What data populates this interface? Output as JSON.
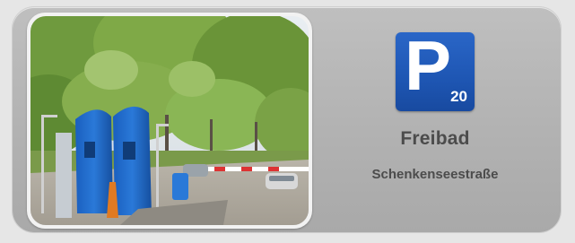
{
  "parking": {
    "sign_letter": "P",
    "sign_number": "20",
    "name": "Freibad",
    "street": "Schenkenseestraße"
  },
  "photo": {
    "icon": "parking-lot-photo"
  },
  "colors": {
    "sign_blue": "#1e56b3",
    "card_gray": "#b7b7b7",
    "text_gray": "#4c4c4c"
  }
}
